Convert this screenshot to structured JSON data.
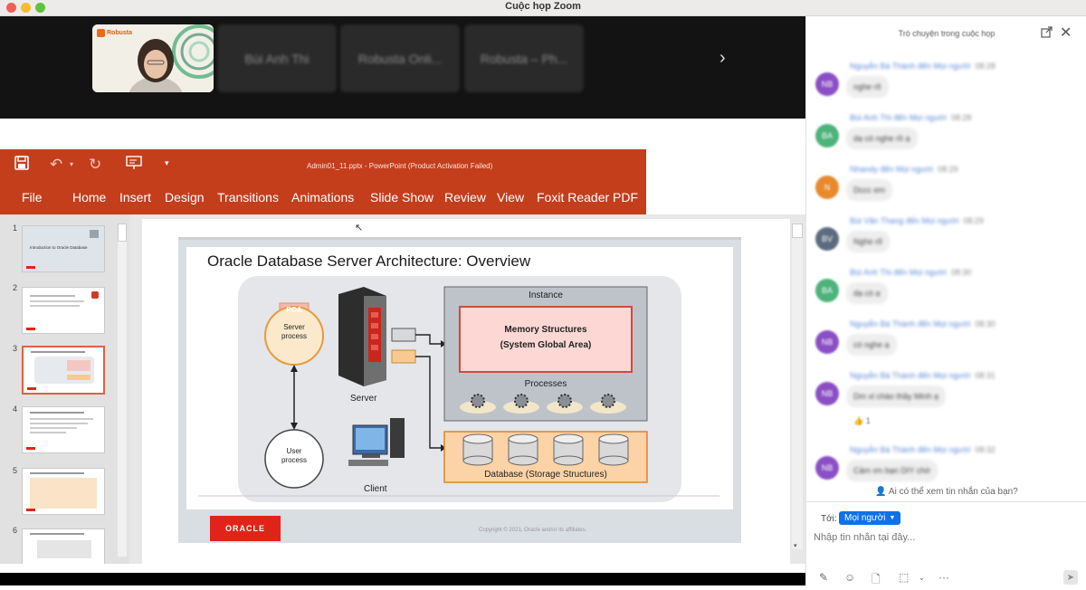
{
  "window": {
    "title": "Cuộc họp Zoom"
  },
  "gallery": {
    "self_logo": "Robusta",
    "participants": [
      "Bùi Anh Thi",
      "Robusta Onli...",
      "Robusta – Ph..."
    ]
  },
  "powerpoint": {
    "doc_title": "Admin01_11.pptx - PowerPoint (Product Activation Failed)",
    "menu": [
      "File",
      "Home",
      "Insert",
      "Design",
      "Transitions",
      "Animations",
      "Slide Show",
      "Review",
      "View",
      "Foxit Reader PDF"
    ]
  },
  "thumbs": {
    "numbers": [
      "1",
      "2",
      "3",
      "4",
      "5",
      "6"
    ],
    "slide1_title": "Introduction to Oracle Database"
  },
  "slide": {
    "title": "Oracle Database Server Architecture: Overview",
    "pga": "PGA",
    "server_process": "Server process",
    "server": "Server",
    "user_process": "User process",
    "client": "Client",
    "instance": "Instance",
    "memory1": "Memory Structures",
    "memory2": "(System Global Area)",
    "processes": "Processes",
    "database": "Database (Storage Structures)",
    "oracle_logo": "ORACLE",
    "copyright": "Copyright © 2021, Oracle and/or its affiliates."
  },
  "chat": {
    "title": "Trò chuyện trong cuộc họp",
    "messages": [
      {
        "sender": "Nguyễn Bá Thành đến Mọi người",
        "time": "08:28",
        "text": "nghe rõ",
        "initials": "NB"
      },
      {
        "sender": "Bùi Anh Thi đến Mọi người",
        "time": "08:28",
        "text": "dạ có nghe rồ ạ",
        "initials": "BA"
      },
      {
        "sender": "Nhandy đến Mọi người",
        "time": "08:29",
        "text": "Dccc em",
        "initials": "N"
      },
      {
        "sender": "Bùi Văn Thang đến Mọi người",
        "time": "08:29",
        "text": "Nghe rõ",
        "initials": "BV"
      },
      {
        "sender": "Bùi Anh Thi đến Mọi người",
        "time": "08:30",
        "text": "dạ có ạ",
        "initials": "BA"
      },
      {
        "sender": "Nguyễn Bá Thành đến Mọi người",
        "time": "08:30",
        "text": "có nghe ạ",
        "initials": "NB"
      },
      {
        "sender": "Nguyễn Bá Thành đến Mọi người",
        "time": "08:31",
        "text": "Dm xl chào thầy Minh ạ",
        "initials": "NB",
        "reaction": "👍 1"
      },
      {
        "sender": "Nguyễn Bá Thành đến Mọi người",
        "time": "08:32",
        "text": "Cảm ơn bạn DIY chờ",
        "initials": "NB"
      }
    ],
    "who_can_see": "Ai có thể xem tin nhắn của bạn?",
    "to_label": "Tới:",
    "recipient": "Mọi người",
    "input_placeholder": "Nhập tin nhắn tại đây..."
  },
  "colors": {
    "ribbon": "#c43e1c",
    "recipient_button": "#0e71eb",
    "avatar_purple": "#8a4fc5",
    "avatar_green": "#4db37a",
    "avatar_orange": "#e88a2c",
    "avatar_slate": "#5c6c80",
    "oracle_red": "#e2231a"
  },
  "icons": [
    "save-icon",
    "undo-icon",
    "redo-icon",
    "present-icon",
    "customize-icon",
    "chevron-right-icon",
    "pop-out-icon",
    "close-icon",
    "person-icon",
    "format-icon",
    "emoji-icon",
    "file-icon",
    "screenshot-icon",
    "more-icon",
    "send-icon"
  ]
}
